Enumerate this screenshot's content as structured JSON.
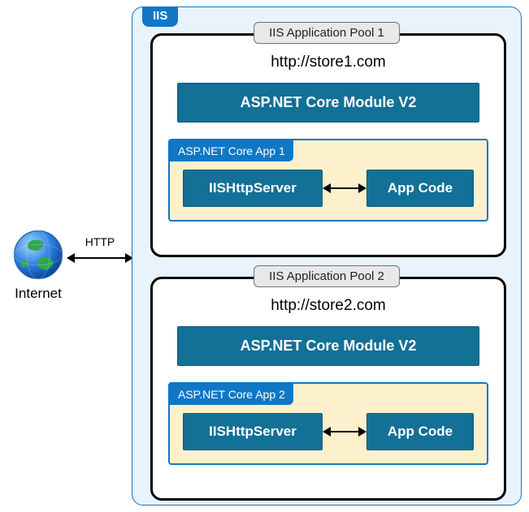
{
  "iis_label": "IIS",
  "internet_label": "Internet",
  "http_label": "HTTP",
  "pools": [
    {
      "title": "IIS Application Pool 1",
      "url": "http://store1.com",
      "module": "ASP.NET Core Module V2",
      "app_label": "ASP.NET Core App 1",
      "httpserver": "IISHttpServer",
      "appcode": "App Code"
    },
    {
      "title": "IIS Application Pool 2",
      "url": "http://store2.com",
      "module": "ASP.NET Core Module V2",
      "app_label": "ASP.NET Core App 2",
      "httpserver": "IISHttpServer",
      "appcode": "App Code"
    }
  ]
}
